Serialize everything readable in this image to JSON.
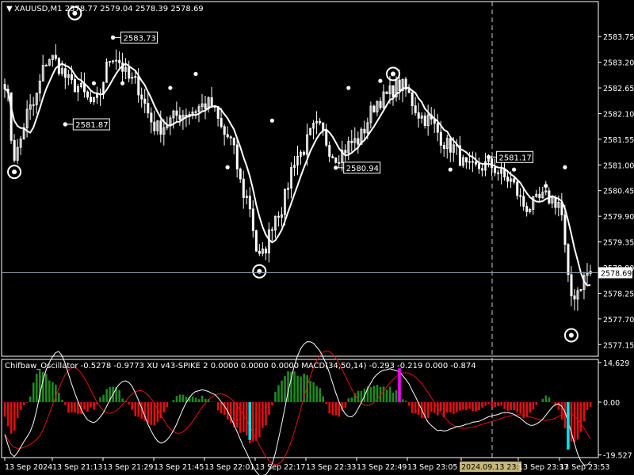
{
  "chart_data": {
    "type": "candlestick",
    "symbol_header": {
      "symbol": "XAUUSD,M1",
      "ohlc": "2578.77 2579.04 2578.39 2578.69"
    },
    "price_axis": {
      "ylim": [
        2576.9,
        2584.5
      ],
      "ticks": [
        "2583.75",
        "2583.20",
        "2582.65",
        "2582.10",
        "2581.55",
        "2581.00",
        "2580.45",
        "2579.90",
        "2579.35",
        "2578.80",
        "2578.25",
        "2577.70",
        "2577.15"
      ],
      "tick_values": [
        2583.75,
        2583.2,
        2582.65,
        2582.1,
        2581.55,
        2581.0,
        2580.45,
        2579.9,
        2579.35,
        2578.8,
        2578.25,
        2577.7,
        2577.15
      ],
      "current_price_label": "2578.69",
      "current_price": 2578.69
    },
    "time_axis": {
      "labels": [
        "13 Sep 2024",
        "13 Sep 21:13",
        "13 Sep 21:29",
        "13 Sep 21:45",
        "13 Sep 22:01",
        "13 Sep 22:17",
        "13 Sep 22:33",
        "13 Sep 22:49",
        "13 Sep 23:05",
        "2024.09.13 23:31",
        "13 Sep 23:37",
        "13 Sep 23:53"
      ],
      "highlight_label": "2024.09.13 23:31"
    },
    "price_labels": [
      {
        "text": "2583.73",
        "value": 2583.73,
        "idx": 34
      },
      {
        "text": "2581.87",
        "value": 2581.87,
        "idx": 19
      },
      {
        "text": "2580.94",
        "value": 2580.94,
        "idx": 104
      },
      {
        "text": "2581.17",
        "value": 2581.17,
        "idx": 152
      }
    ],
    "circled_points": [
      {
        "idx": 3,
        "value": 2580.85
      },
      {
        "idx": 22,
        "value": 2584.25
      },
      {
        "idx": 80,
        "value": 2578.72
      },
      {
        "idx": 122,
        "value": 2582.95
      },
      {
        "idx": 178,
        "value": 2577.35
      }
    ],
    "oscillator": {
      "header": "Chifbaw_Oscillator -0.5278 -0.9773  XU v43-SPIKE 2 0.0000 0.0000 0.0000  MACD(34,50,14) -0.293 -0.219 0.000 -0.874",
      "ylim": [
        -20.5,
        15.8
      ],
      "ticks": [
        "14.629",
        "0.00",
        "-19.527"
      ],
      "tick_values": [
        14.629,
        0.0,
        -19.527
      ],
      "spikes": [
        {
          "idx": 77,
          "value": -14.0,
          "color": "#00e5ee"
        },
        {
          "idx": 124,
          "value": 12.5,
          "color": "#ff00ff"
        },
        {
          "idx": 177,
          "value": -17.5,
          "color": "#00e5ee"
        }
      ]
    },
    "colors": {
      "background": "#000000",
      "candles": "#ffffff",
      "moving_average": "#ffffff",
      "hist_positive": "#1f8a1f",
      "hist_negative": "#e01010",
      "signal_line": "#e01010",
      "macd_line": "#ffffff",
      "price_line": "#8aa0b4",
      "highlight_time_bg": "#c8b878"
    }
  }
}
